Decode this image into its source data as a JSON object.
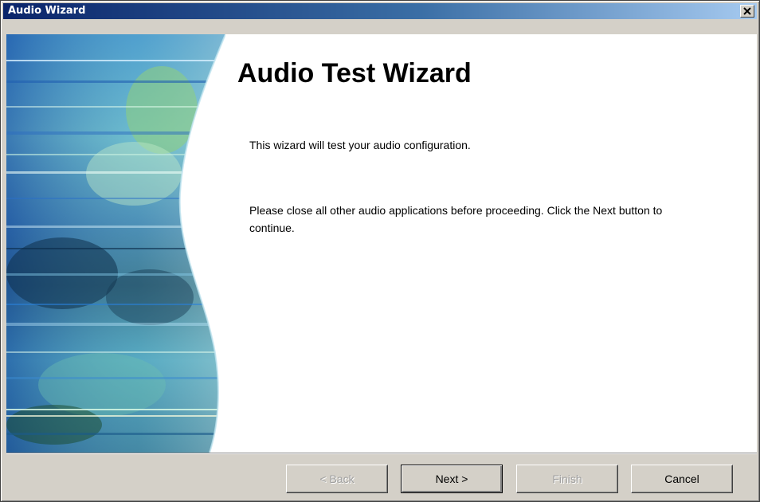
{
  "window": {
    "title": "Audio Wizard"
  },
  "main": {
    "heading": "Audio Test Wizard",
    "paragraph1": "This wizard will test your audio configuration.",
    "paragraph2": "Please close all other audio applications before proceeding. Click the Next button to continue."
  },
  "buttons": {
    "back": {
      "label": "< Back",
      "enabled": false
    },
    "next": {
      "label": "Next >",
      "enabled": true
    },
    "finish": {
      "label": "Finish",
      "enabled": false
    },
    "cancel": {
      "label": "Cancel",
      "enabled": true
    }
  },
  "icons": {
    "close": "close-icon"
  },
  "colors": {
    "title_gradient_start": "#0a246a",
    "title_gradient_end": "#a6caf0",
    "dialog_face": "#d4d0c8",
    "content_bg": "#ffffff"
  }
}
